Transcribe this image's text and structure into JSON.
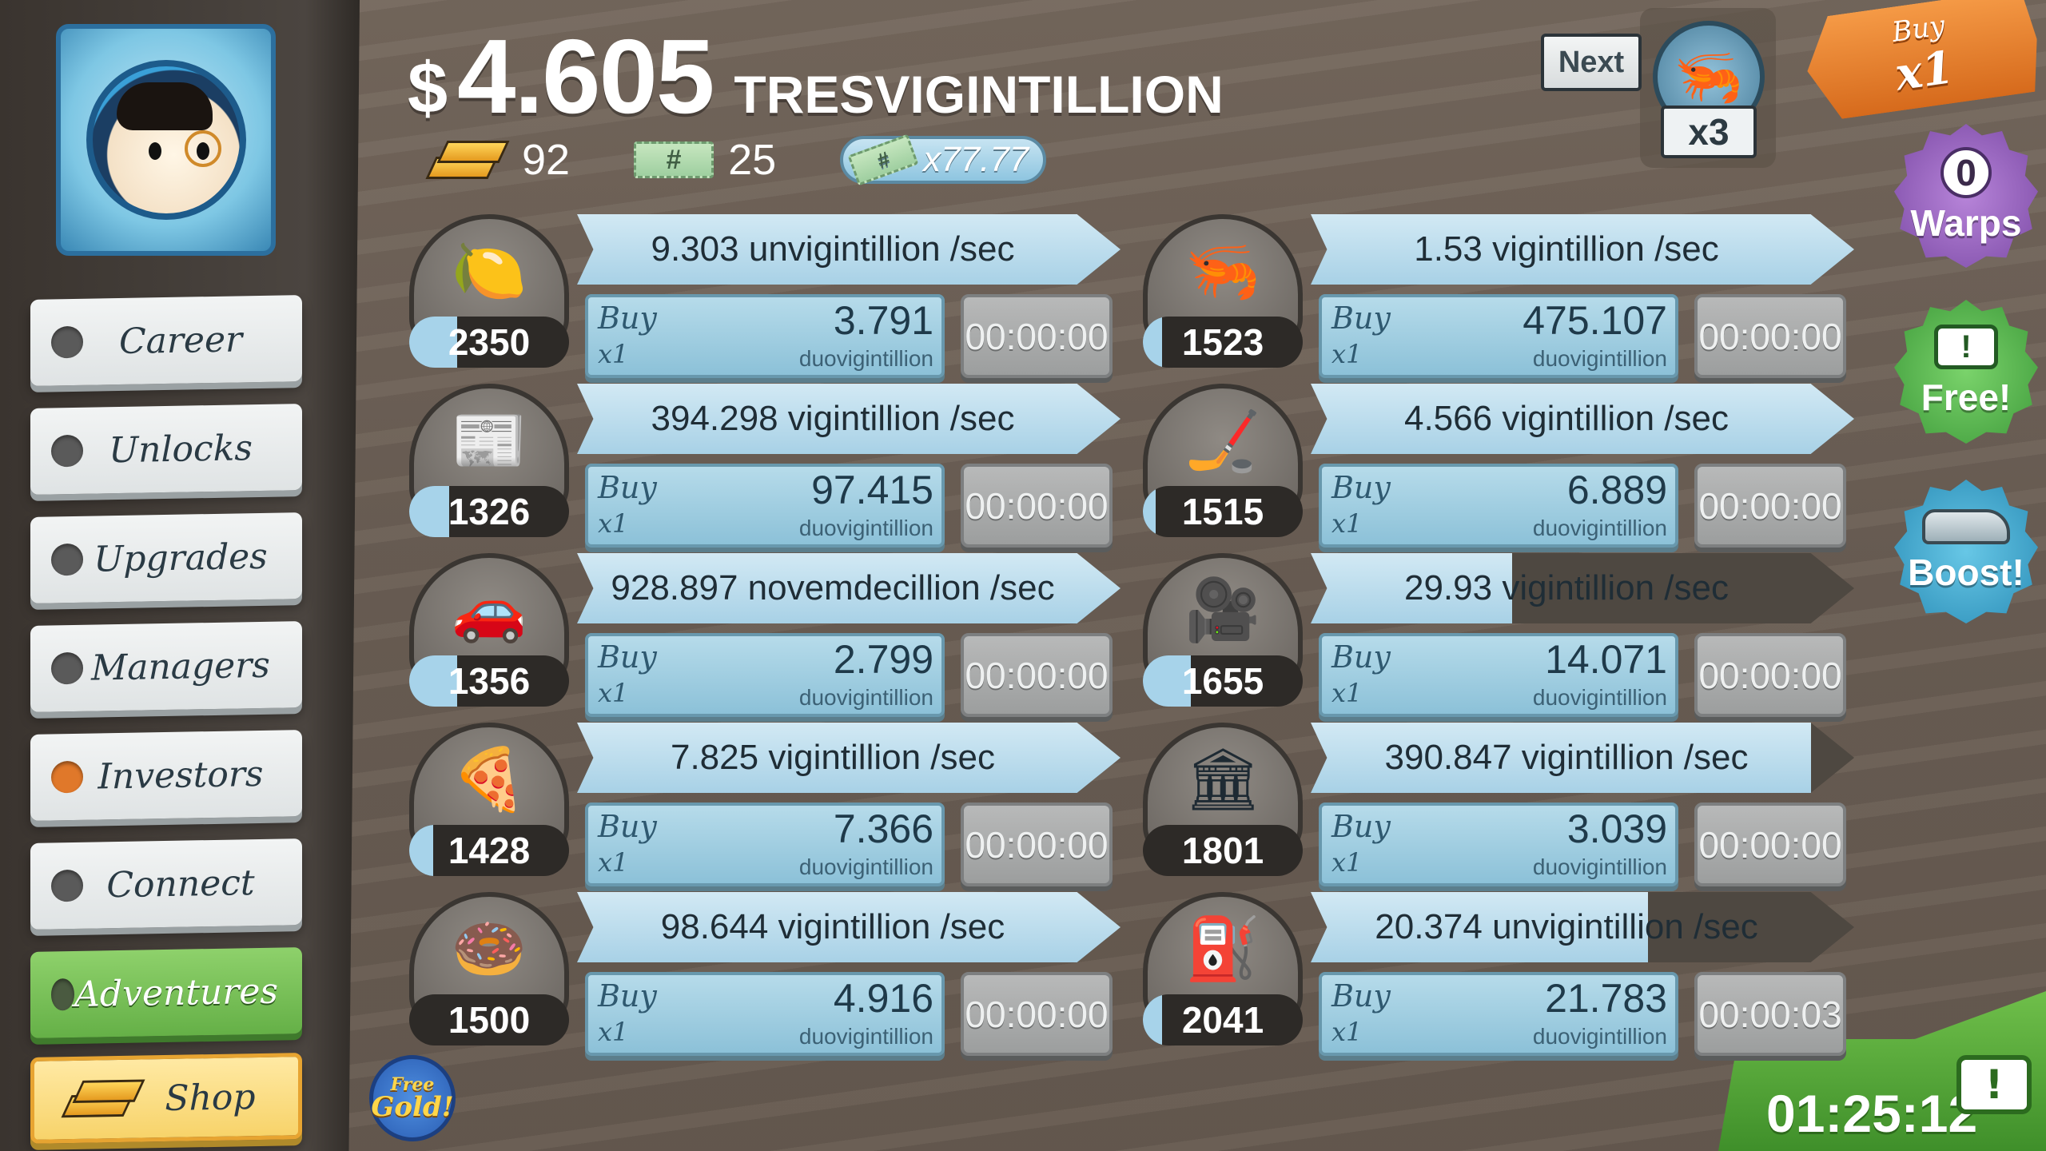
{
  "header": {
    "currency_symbol": "$",
    "money_amount": "4.605",
    "money_unit": "TRESVIGINTILLION",
    "gold_count": "92",
    "megaticket_count": "25",
    "megaticket_multiplier": "x77.77",
    "ticket_symbol": "#"
  },
  "next_unlock": {
    "label": "Next",
    "multiplier": "x3",
    "icon": "shrimp-icon"
  },
  "buy_mode": {
    "line1": "Buy",
    "line2": "x1"
  },
  "sidebar": {
    "items": [
      {
        "label": "Career",
        "dot_color": "#5a5a5a"
      },
      {
        "label": "Unlocks",
        "dot_color": "#5a5a5a"
      },
      {
        "label": "Upgrades",
        "dot_color": "#5a5a5a"
      },
      {
        "label": "Managers",
        "dot_color": "#5a5a5a"
      },
      {
        "label": "Investors",
        "dot_color": "#e0782a"
      },
      {
        "label": "Connect",
        "dot_color": "#5a5a5a"
      },
      {
        "label": "Adventures",
        "dot_color": "#4a5a40"
      }
    ],
    "shop_label": "Shop"
  },
  "right_badges": {
    "warps_count": "0",
    "warps_label": "Warps",
    "free_label": "Free!",
    "tv_symbol": "!",
    "boost_label": "Boost!"
  },
  "free_gold": {
    "line1": "Free",
    "line2": "Gold!"
  },
  "timer": {
    "value": "01:25:12",
    "tv_symbol": "!"
  },
  "businesses_left": [
    {
      "icon": "lemon-icon",
      "glyph": "🍋",
      "count": "2350",
      "count_fill": 0.3,
      "rate": "9.303 unvigintillion /sec",
      "rate_fill": 1.0,
      "buy": "Buy",
      "qty": "x1",
      "cost": "3.791",
      "cost_unit": "duovigintillion",
      "time": "00:00:00"
    },
    {
      "icon": "newspaper-icon",
      "glyph": "📰",
      "count": "1326",
      "count_fill": 0.25,
      "rate": "394.298 vigintillion /sec",
      "rate_fill": 1.0,
      "buy": "Buy",
      "qty": "x1",
      "cost": "97.415",
      "cost_unit": "duovigintillion",
      "time": "00:00:00"
    },
    {
      "icon": "car-wash-icon",
      "glyph": "🚗",
      "count": "1356",
      "count_fill": 0.3,
      "rate": "928.897 novemdecillion /sec",
      "rate_fill": 1.0,
      "buy": "Buy",
      "qty": "x1",
      "cost": "2.799",
      "cost_unit": "duovigintillion",
      "time": "00:00:00"
    },
    {
      "icon": "pizza-icon",
      "glyph": "🍕",
      "count": "1428",
      "count_fill": 0.15,
      "rate": "7.825 vigintillion /sec",
      "rate_fill": 1.0,
      "buy": "Buy",
      "qty": "x1",
      "cost": "7.366",
      "cost_unit": "duovigintillion",
      "time": "00:00:00"
    },
    {
      "icon": "donut-icon",
      "glyph": "🍩",
      "count": "1500",
      "count_fill": 0.0,
      "rate": "98.644 vigintillion /sec",
      "rate_fill": 1.0,
      "buy": "Buy",
      "qty": "x1",
      "cost": "4.916",
      "cost_unit": "duovigintillion",
      "time": "00:00:00"
    }
  ],
  "businesses_right": [
    {
      "icon": "shrimp-icon",
      "glyph": "🦐",
      "count": "1523",
      "count_fill": 0.12,
      "rate": "1.53 vigintillion /sec",
      "rate_fill": 1.0,
      "buy": "Buy",
      "qty": "x1",
      "cost": "475.107",
      "cost_unit": "duovigintillion",
      "time": "00:00:00"
    },
    {
      "icon": "hockey-stick-icon",
      "glyph": "🏒",
      "count": "1515",
      "count_fill": 0.08,
      "rate": "4.566 vigintillion /sec",
      "rate_fill": 1.0,
      "buy": "Buy",
      "qty": "x1",
      "cost": "6.889",
      "cost_unit": "duovigintillion",
      "time": "00:00:00"
    },
    {
      "icon": "movie-camera-icon",
      "glyph": "🎥",
      "count": "1655",
      "count_fill": 0.3,
      "rate": "29.93 vigintillion /sec",
      "rate_fill": 0.37,
      "buy": "Buy",
      "qty": "x1",
      "cost": "14.071",
      "cost_unit": "duovigintillion",
      "time": "00:00:00"
    },
    {
      "icon": "bank-icon",
      "glyph": "🏛",
      "count": "1801",
      "count_fill": 0.0,
      "rate": "390.847 vigintillion /sec",
      "rate_fill": 0.92,
      "buy": "Buy",
      "qty": "x1",
      "cost": "3.039",
      "cost_unit": "duovigintillion",
      "time": "00:00:00"
    },
    {
      "icon": "oil-rig-icon",
      "glyph": "⛽",
      "count": "2041",
      "count_fill": 0.12,
      "rate": "20.374 unvigintillion /sec",
      "rate_fill": 0.62,
      "buy": "Buy",
      "qty": "x1",
      "cost": "21.783",
      "cost_unit": "duovigintillion",
      "time": "00:00:03"
    }
  ]
}
